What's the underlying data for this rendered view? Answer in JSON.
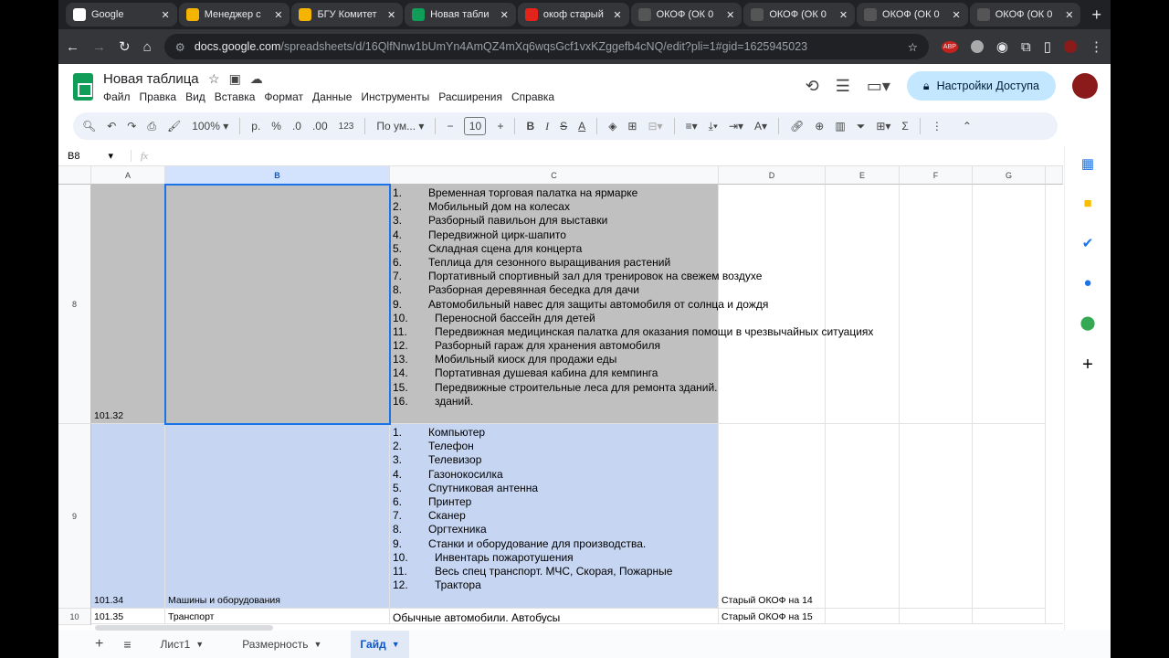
{
  "browser": {
    "tabs": [
      {
        "label": "Google",
        "color": "#fff"
      },
      {
        "label": "Менеджер с",
        "color": "#f5b400"
      },
      {
        "label": "БГУ Комитет",
        "color": "#f5b400"
      },
      {
        "label": "Новая табли",
        "color": "#0f9d58"
      },
      {
        "label": "окоф старый",
        "color": "#e3241b"
      },
      {
        "label": "ОКОФ (ОК 0",
        "color": "#555"
      },
      {
        "label": "ОКОФ (ОК 0",
        "color": "#555"
      },
      {
        "label": "ОКОФ (ОК 0",
        "color": "#555"
      },
      {
        "label": "ОКОФ (ОК 0",
        "color": "#555"
      }
    ],
    "url_host": "docs.google.com",
    "url_path": "/spreadsheets/d/16QlfNnw1bUmYn4AmQZ4mXq6wqsGcf1vxKZggefb4cNQ/edit?pli=1#gid=1625945023",
    "ext_abp": "ABP"
  },
  "doc": {
    "title": "Новая таблица",
    "menu": [
      "Файл",
      "Правка",
      "Вид",
      "Вставка",
      "Формат",
      "Данные",
      "Инструменты",
      "Расширения",
      "Справка"
    ],
    "share_label": "Настройки Доступа"
  },
  "toolbar": {
    "zoom": "100%",
    "currency": "р.",
    "percent": "%",
    "dec_less": ".0",
    "dec_more": ".00",
    "number_format": "123",
    "font": "По ум...",
    "font_size": "10"
  },
  "formula_bar": {
    "cell_ref": "B8",
    "fx": "fx",
    "value": ""
  },
  "columns": [
    "A",
    "B",
    "C",
    "D",
    "E",
    "F",
    "G"
  ],
  "rows": [
    {
      "num": "8",
      "A": "101.32",
      "B": "",
      "D": "",
      "list": [
        "Временная торговая палатка на ярмарке",
        "Мобильный дом на колесах",
        "Разборный павильон для выставки",
        "Передвижной цирк-шапито",
        "Складная сцена для концерта",
        "Теплица для сезонного выращивания растений",
        "Портативный спортивный зал для тренировок на свежем воздухе",
        "Разборная деревянная беседка для дачи",
        "Автомобильный навес для защиты автомобиля от солнца и дождя",
        "Переносной бассейн для детей",
        "Передвижная медицинская палатка для оказания помощи в чрезвычайных ситуациях",
        "Разборный гараж для хранения автомобиля",
        "Мобильный киоск для продажи еды",
        "Портативная душевая кабина для кемпинга",
        "Передвижные строительные леса для ремонта зданий.",
        "зданий."
      ]
    },
    {
      "num": "9",
      "A": "101.34",
      "B": "Машины и оборудования",
      "D": "Старый ОКОФ на 14",
      "list": [
        "Компьютер",
        "Телефон",
        "Телевизор",
        "Газонокосилка",
        "Спутниковая антенна",
        "Принтер",
        "Сканер",
        "Оргтехника",
        "Станки и оборудование для производства.",
        "Инвентарь пожаротушения",
        "Весь спец транспорт. МЧС, Скорая, Пожарные",
        "Трактора"
      ]
    },
    {
      "num": "10",
      "A": "101.35",
      "B": "Транспорт",
      "C": "Обычные автомобили. Автобусы",
      "D": "Старый ОКОФ на 15"
    }
  ],
  "sheets": [
    {
      "label": "Лист1"
    },
    {
      "label": "Размерность"
    },
    {
      "label": "Гайд",
      "active": true
    }
  ],
  "colors": {
    "selection": "#c6d5f1",
    "gray_fill": "#c0c0c0",
    "accent": "#0b57d0"
  }
}
